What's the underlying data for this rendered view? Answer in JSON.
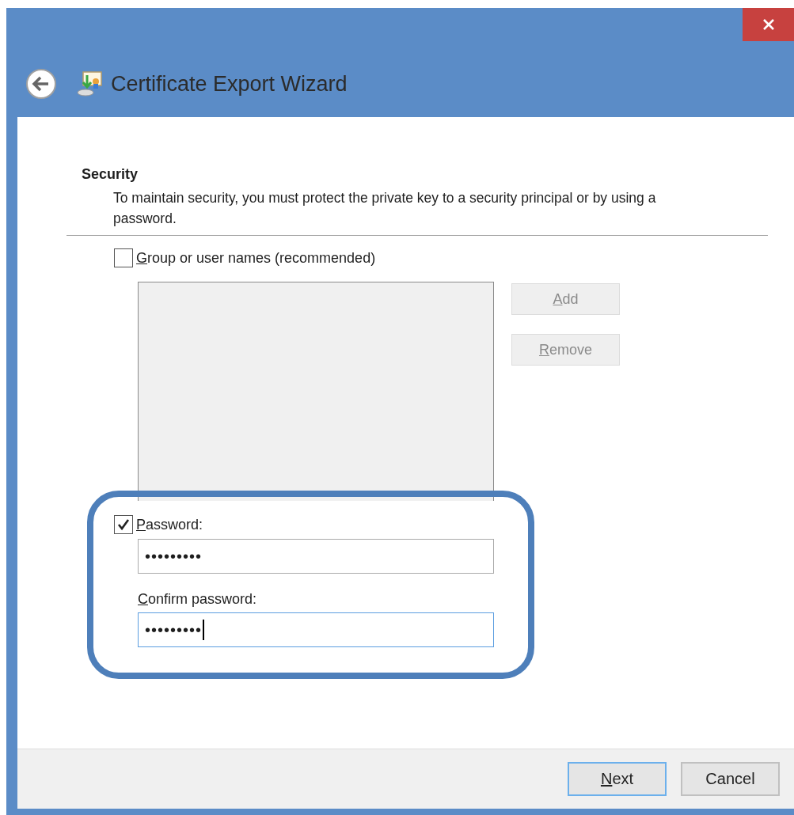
{
  "window": {
    "title": "Certificate Export Wizard"
  },
  "section": {
    "heading": "Security",
    "description": "To maintain security, you must protect the private key to a security principal or by using a password."
  },
  "principals": {
    "checkbox": {
      "label": "Group or user names (recommended)",
      "checked": false,
      "mnemonic": true
    },
    "buttons": [
      {
        "label": "Add",
        "disabled": true,
        "mnemonic": true
      },
      {
        "label": "Remove",
        "disabled": true,
        "mnemonic": true
      }
    ]
  },
  "password": {
    "checkbox": {
      "label": "Password:",
      "checked": true,
      "mnemonic": true
    },
    "value": "•••••••••",
    "focused": false
  },
  "confirm": {
    "label": "Confirm password:",
    "mnemonic": true,
    "value": "•••••••••",
    "focused": true
  },
  "footer": {
    "buttons": [
      {
        "label": "Next",
        "default": true,
        "mnemonic": true
      },
      {
        "label": "Cancel",
        "default": false,
        "mnemonic": false
      }
    ]
  }
}
